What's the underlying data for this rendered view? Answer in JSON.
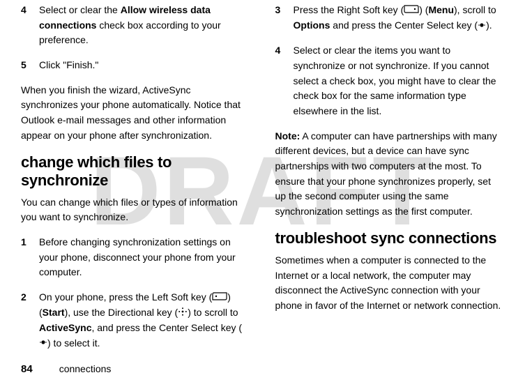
{
  "watermark": "DRAFT",
  "left_column": {
    "step4": {
      "num": "4",
      "pre": "Select or clear the ",
      "bold": "Allow wireless data connections",
      "post": " check box according to your preference."
    },
    "step5": {
      "num": "5",
      "text": "Click \"Finish.\""
    },
    "wizard_para": "When you finish the wizard, ActiveSync synchronizes your phone automatically. Notice that Outlook e-mail messages and other information appear on your phone after synchronization.",
    "heading": "change which files to synchronize",
    "sub_para": "You can change which files or types of information you want to synchronize.",
    "step1": {
      "num": "1",
      "text": "Before changing synchronization settings on your phone, disconnect your phone from your computer."
    },
    "step2": {
      "num": "2",
      "pre": "On your phone, press the Left Soft key (",
      "post_softkey": ") (",
      "start_label": "Start",
      "mid1": "), use the Directional key (",
      "mid2": ") to scroll to ",
      "activesync_label": "ActiveSync",
      "mid3": ", and press the Center Select key (",
      "end": ") to select it."
    }
  },
  "right_column": {
    "step3": {
      "num": "3",
      "pre": "Press the Right Soft key (",
      "post_softkey": ") (",
      "menu_label": "Menu",
      "mid1": "), scroll to ",
      "options_label": "Options",
      "mid2": " and press the Center Select key (",
      "end": ")."
    },
    "step4r": {
      "num": "4",
      "text": "Select or clear the items you want to synchronize or not synchronize. If you cannot select a check box, you might have to clear the check box for the same information type elsewhere in the list."
    },
    "note_label": "Note:",
    "note_text": " A computer can have partnerships with many different devices, but a device can have sync partnerships with two computers at the most. To ensure that your phone synchronizes properly, set up the second computer using the same synchronization settings as the first computer.",
    "heading2": "troubleshoot sync connections",
    "trouble_para": "Sometimes when a computer is connected to the Internet or a local network, the computer may disconnect the ActiveSync connection with your phone in favor of the Internet or network connection."
  },
  "footer": {
    "page_number": "84",
    "section": "connections"
  }
}
